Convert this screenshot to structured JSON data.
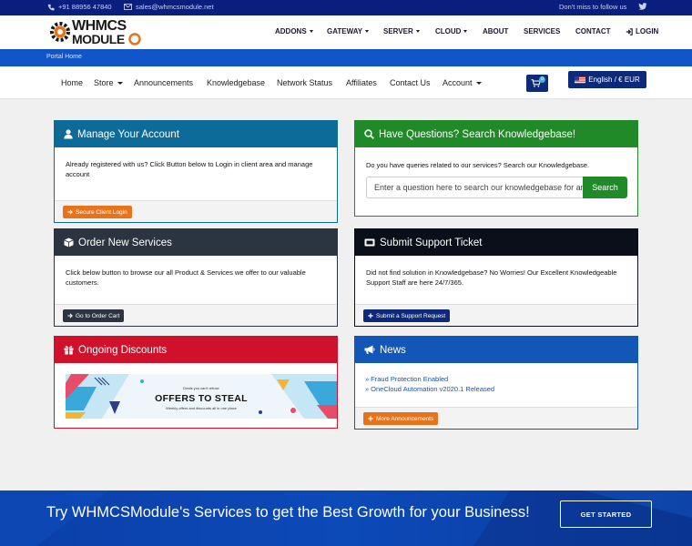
{
  "topbar": {
    "phone": "+91 88956 47840",
    "email": "sales@whmcsmodule.net",
    "follow_text": "Don't miss to follow us"
  },
  "logo": {
    "line1": "WHMCS",
    "line2": "MODULE"
  },
  "mainnav": {
    "items": [
      {
        "label": "ADDONS",
        "dropdown": true
      },
      {
        "label": "GATEWAY",
        "dropdown": true
      },
      {
        "label": "SERVER",
        "dropdown": true
      },
      {
        "label": "CLOUD",
        "dropdown": true
      },
      {
        "label": "ABOUT",
        "dropdown": false
      },
      {
        "label": "SERVICES",
        "dropdown": false
      },
      {
        "label": "CONTACT",
        "dropdown": false
      },
      {
        "label": "LOGIN",
        "dropdown": false
      }
    ]
  },
  "breadcrumb": {
    "label": "Portal Home"
  },
  "subnav": {
    "items": [
      {
        "label": "Home"
      },
      {
        "label": "Store"
      },
      {
        "label": "Announcements"
      },
      {
        "label": "Knowledgebase"
      },
      {
        "label": "Network Status"
      },
      {
        "label": "Affiliates"
      },
      {
        "label": "Contact Us"
      },
      {
        "label": "Account"
      }
    ],
    "cart_count": "0",
    "language": "English / € EUR"
  },
  "panels": {
    "manage": {
      "title": "Manage Your Account",
      "body": "Already registered with us? Click Button below to Login in client area and manage account",
      "button": "Secure Client Login"
    },
    "order": {
      "title": "Order New Services",
      "body": "Click below button to browse our all Product & Services we offer to our valuable customers.",
      "button": "Go to Order Cart"
    },
    "discounts": {
      "title": "Ongoing Discounts",
      "banner_top": "Deals you can't refuse",
      "banner_title": "OFFERS TO STEAL",
      "banner_sub": "Weekly offers and discounts all in one place"
    },
    "kb": {
      "title": "Have Questions? Search Knowledgebase!",
      "body": "Do you have queries related to our services? Search our Knowledgebase.",
      "placeholder": "Enter a question here to search our knowledgebase for answers...",
      "button": "Search"
    },
    "ticket": {
      "title": "Submit Support Ticket",
      "body": "Did not find solution in Knowledgebase? No Worries! Our Excellent Knowledgeable Support Staff are here 24/7/365.",
      "button": "Submit a Support Request"
    },
    "news": {
      "title": "News",
      "items": [
        "Fraud Protection Enabled",
        "OneCloud Automation v2020.1 Released"
      ],
      "button": "More Announcements"
    }
  },
  "footer": {
    "text": "Try WHMCSModule's Services to get the Best Growth for your Business!",
    "button": "GET STARTED"
  },
  "colors": {
    "topbar": "#0a1e7d",
    "crumbbar": "#1255c9",
    "manage": "#0d6b9a",
    "order": "#2c3441",
    "discounts": "#d0112b",
    "kb": "#1f8a27",
    "ticket": "#0b0f1a",
    "news": "#1256b8",
    "orange_button": "#e8731a"
  }
}
